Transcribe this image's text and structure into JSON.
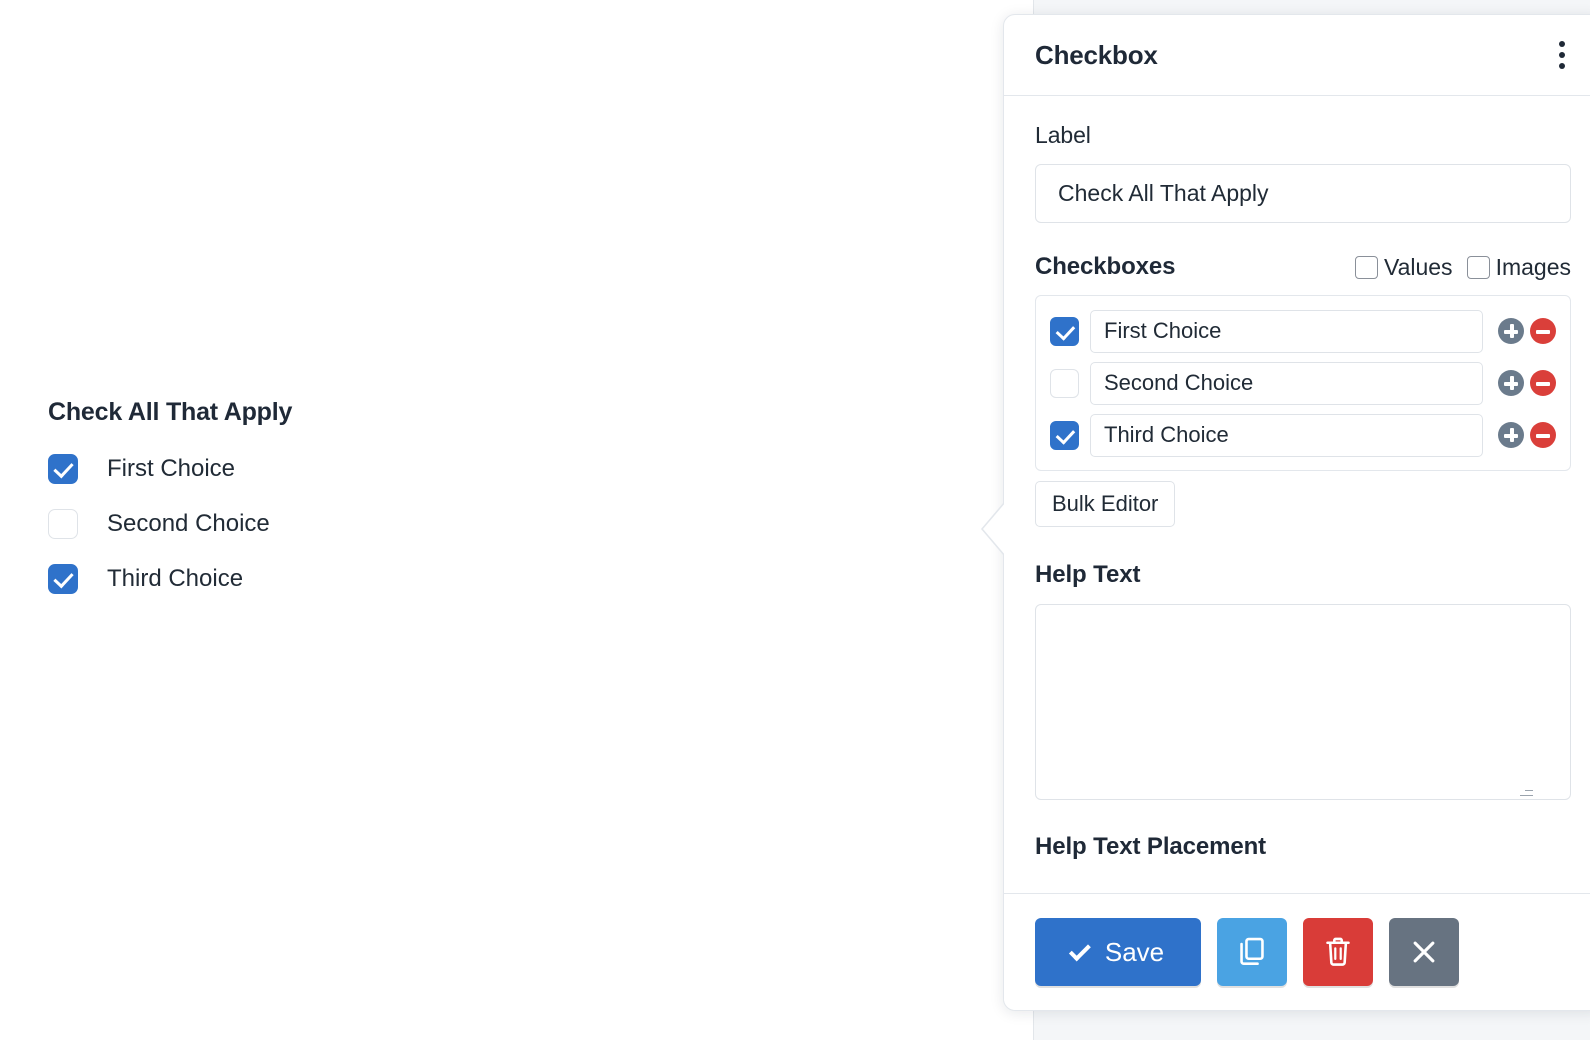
{
  "preview": {
    "label": "Check All That Apply",
    "options": [
      {
        "label": "First Choice",
        "checked": true
      },
      {
        "label": "Second Choice",
        "checked": false
      },
      {
        "label": "Third Choice",
        "checked": true
      }
    ]
  },
  "panel": {
    "title": "Checkbox",
    "menu_icon": "kebab-menu-icon",
    "label_field": {
      "label": "Label",
      "value": "Check All That Apply",
      "placeholder": ""
    },
    "checkboxes_section": {
      "title": "Checkboxes",
      "toggles": [
        {
          "label": "Values",
          "checked": false
        },
        {
          "label": "Images",
          "checked": false
        }
      ],
      "rows": [
        {
          "checked": true,
          "value": "First Choice",
          "add_icon": "plus-circle-icon",
          "remove_icon": "minus-circle-icon"
        },
        {
          "checked": false,
          "value": "Second Choice",
          "add_icon": "plus-circle-icon",
          "remove_icon": "minus-circle-icon"
        },
        {
          "checked": true,
          "value": "Third Choice",
          "add_icon": "plus-circle-icon",
          "remove_icon": "minus-circle-icon"
        }
      ],
      "bulk_editor_label": "Bulk Editor"
    },
    "help_text": {
      "label": "Help Text",
      "value": "",
      "placeholder": ""
    },
    "help_text_placement": {
      "label": "Help Text Placement"
    },
    "footer": {
      "save_label": "Save",
      "save_icon": "check-icon",
      "copy_icon": "copy-icon",
      "delete_icon": "trash-icon",
      "close_icon": "close-icon"
    }
  },
  "colors": {
    "accent_blue": "#2f72ca",
    "copy_blue": "#4aa3e3",
    "danger_red": "#d93c38",
    "neutral_gray": "#677381",
    "add_gray": "#6b7b8c",
    "text_dark": "#212b36",
    "border": "#dfe3e8"
  }
}
